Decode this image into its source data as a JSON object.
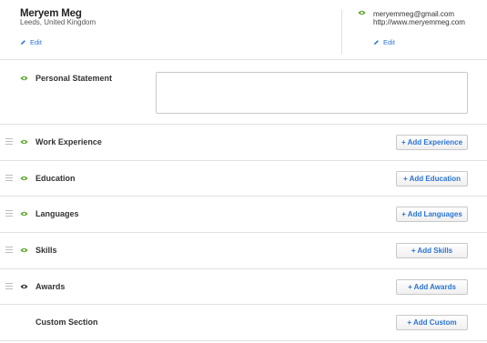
{
  "profile": {
    "name": "Meryem Meg",
    "location": "Leeds, United Kingdom",
    "edit_label": "Edit",
    "email": "meryemmeg@gmail.com",
    "website": "http://www.meryemmeg.com",
    "contact_edit_label": "Edit"
  },
  "personal_statement": {
    "title": "Personal Statement",
    "value": ""
  },
  "sections": [
    {
      "title": "Work Experience",
      "button": "+ Add Experience",
      "visible": true
    },
    {
      "title": "Education",
      "button": "+ Add Education",
      "visible": true
    },
    {
      "title": "Languages",
      "button": "+ Add Languages",
      "visible": true
    },
    {
      "title": "Skills",
      "button": "+ Add Skills",
      "visible": true
    },
    {
      "title": "Awards",
      "button": "+ Add Awards",
      "visible": false
    },
    {
      "title": "Custom Section",
      "button": "+ Add Custom",
      "visible": null
    }
  ],
  "colors": {
    "link": "#2b74d4",
    "eye_visible": "#5aa52b",
    "eye_hidden": "#333333",
    "divider": "#e1e1e1"
  },
  "icons": {
    "edit": "pencil-icon",
    "visibility": "eye-icon",
    "drag": "drag-handle-icon"
  }
}
